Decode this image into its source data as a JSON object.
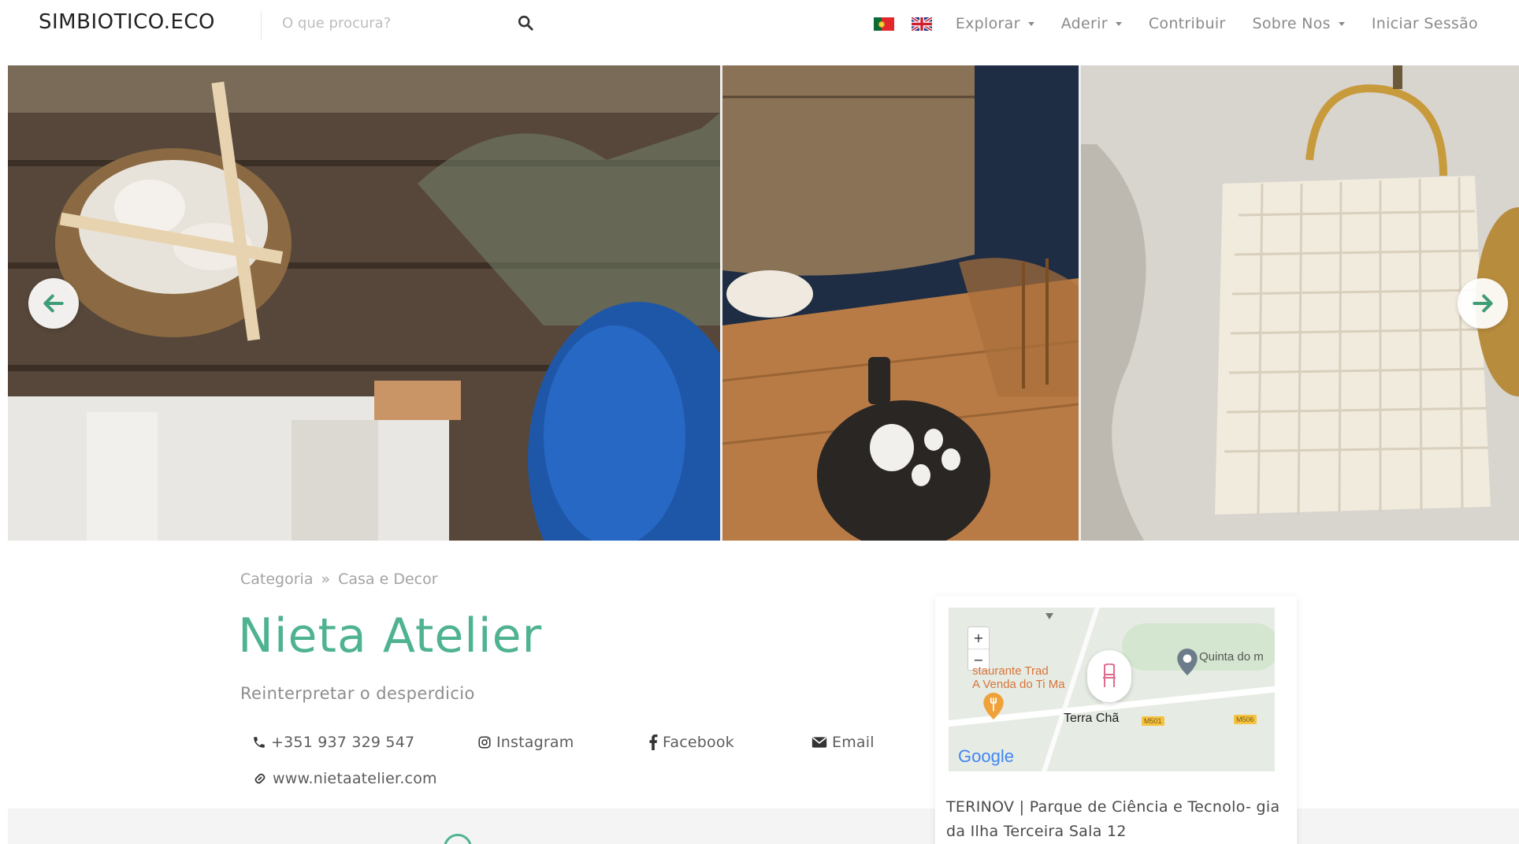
{
  "header": {
    "logo": "SIMBIOTICO.ECO",
    "search_placeholder": "O que procura?",
    "nav": {
      "explorar": "Explorar",
      "aderir": "Aderir",
      "contribuir": "Contribuir",
      "sobre_nos": "Sobre Nos",
      "iniciar_sessao": "Iniciar Sessão"
    }
  },
  "breadcrumb": {
    "category": "Categoria",
    "separator": "»",
    "current": "Casa e Decor"
  },
  "business": {
    "name": "Nieta Atelier",
    "tagline": "Reinterpretar o desperdicio",
    "phone": "+351 937 329 547",
    "instagram": "Instagram",
    "facebook": "Facebook",
    "email": "Email",
    "website": "www.nietaatelier.com",
    "address": "TERINOV | Parque de Ciência e Tecnolo- gia da Ilha Terceira Sala 12"
  },
  "map": {
    "zoom_in": "+",
    "zoom_out": "−",
    "label_restaurant_1": "staurante Trad",
    "label_restaurant_2": "A Venda do Ti Ma",
    "label_quinta": "Quinta do m",
    "label_terra": "Terra Chã",
    "label_m501": "M501",
    "label_m506": "M506",
    "label_google": "Google"
  },
  "colors": {
    "accent": "#4fb390",
    "text_muted": "#8a8a8a"
  }
}
